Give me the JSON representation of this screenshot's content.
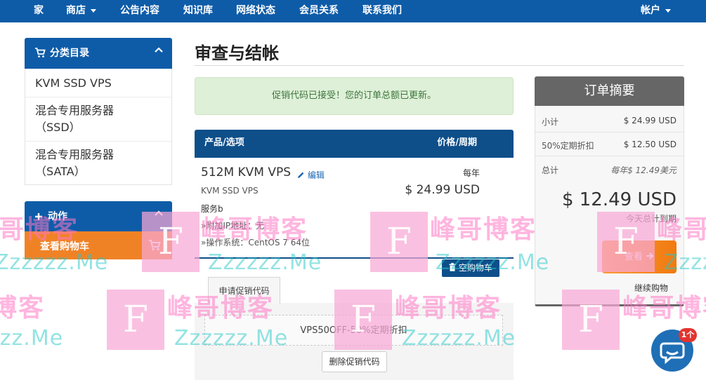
{
  "nav": {
    "home": "家",
    "store": "商店",
    "announcements": "公告内容",
    "knowledgebase": "知识库",
    "network_status": "网络状态",
    "affiliates": "会员关系",
    "contact": "联系我们",
    "account": "帐户"
  },
  "sidebar": {
    "categories_title": "分类目录",
    "categories": [
      "KVM SSD VPS",
      "混合专用服务器",
      "（SSD）",
      "混合专用服务器",
      "（SATA）"
    ],
    "actions_title": "动作",
    "view_cart": "查看购物车"
  },
  "page": {
    "title": "审查与结帐",
    "alert": "促销代码已接受！您的订单总额已更新。"
  },
  "cart": {
    "col_product": "产品/选项",
    "col_price": "价格/周期",
    "item": {
      "name": "512M KVM VPS",
      "edit": "编辑",
      "group": "KVM SSD VPS",
      "hostname": "服务b",
      "option_ip": "»附加IP地址：无",
      "option_os": "»操作系统：CentOS 7 64位",
      "cycle": "每年",
      "price": "$ 24.99 USD"
    },
    "empty_cart": "空购物车",
    "promo_tab": "申请促销代码",
    "promo_code": "VPS50OFF-50%定期折扣",
    "remove_promo": "删除促销代码"
  },
  "summary": {
    "title": "订单摘要",
    "subtotal_label": "小计",
    "subtotal_value": "$ 24.99 USD",
    "discount_label": "50%定期折扣",
    "discount_value": "$ 12.50 USD",
    "totals_label": "总计",
    "totals_value": "每年$ 12.49美元",
    "total_big": "$ 12.49 USD",
    "total_due": "今天总计到期",
    "checkout": "查看",
    "continue": "继续购物"
  },
  "watermark": {
    "text": "峰哥博客",
    "url": "Zzzzzz.Me",
    "letter": "F"
  },
  "chat": {
    "badge": "1个"
  },
  "colors": {
    "primary": "#0e5ca8",
    "cart_header": "#0e4f8a",
    "accent_orange": "#f08226",
    "alert_bg": "#dff0d8",
    "alert_text": "#3c763d",
    "summary_head": "#666666"
  },
  "icons": {
    "categories": "shopping-cart-icon",
    "actions": "plus-icon",
    "edit": "pencil-icon",
    "empty_cart": "trash-icon",
    "checkout": "arrow-right-icon",
    "chat": "chat-icon"
  }
}
